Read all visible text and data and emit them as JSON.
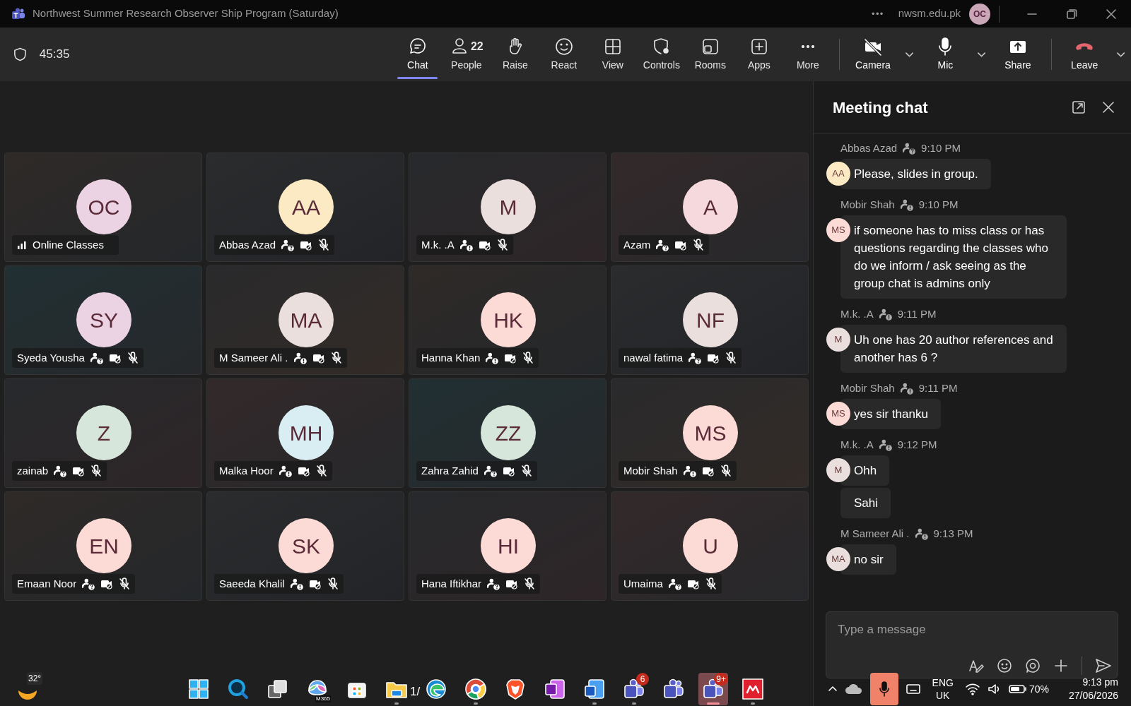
{
  "window": {
    "title": "Northwest Summer Research Observer Ship Program (Saturday)",
    "more": "•••",
    "org": "nwsm.edu.pk",
    "account_initials": "OC"
  },
  "toolbar": {
    "timer": "45:35",
    "buttons": [
      {
        "kind": "chat",
        "label": "Chat",
        "selected": true
      },
      {
        "kind": "people",
        "label": "People",
        "count": "22",
        "selected": false
      },
      {
        "kind": "raise",
        "label": "Raise",
        "selected": false
      },
      {
        "kind": "react",
        "label": "React",
        "selected": false
      },
      {
        "kind": "view",
        "label": "View",
        "selected": false
      },
      {
        "kind": "controls",
        "label": "Controls",
        "selected": false
      },
      {
        "kind": "rooms",
        "label": "Rooms",
        "selected": false
      },
      {
        "kind": "apps",
        "label": "Apps",
        "selected": false
      },
      {
        "kind": "more",
        "label": "More",
        "selected": false
      }
    ],
    "media": [
      {
        "kind": "camera",
        "label": "Camera",
        "dropdown": true
      },
      {
        "kind": "mic",
        "label": "Mic",
        "dropdown": true
      },
      {
        "kind": "share",
        "label": "Share",
        "dropdown": false
      },
      {
        "kind": "leave",
        "label": "Leave",
        "dropdown": true
      }
    ]
  },
  "participants": [
    {
      "kind": "self",
      "initials": "OC",
      "name": "Online Classes",
      "color": "#ecd3e3"
    },
    {
      "kind": "guest",
      "initials": "AA",
      "name": "Abbas Azad",
      "verified": false,
      "color": "#fbeac3"
    },
    {
      "kind": "guest",
      "initials": "M",
      "name": "M.k. .A",
      "verified": true,
      "color": "#eadfdc"
    },
    {
      "kind": "guest",
      "initials": "A",
      "name": "Azam",
      "verified": false,
      "color": "#f6d9dc"
    },
    {
      "kind": "guest",
      "initials": "SY",
      "name": "Syeda Yousha",
      "verified": false,
      "color": "#ecd3e3"
    },
    {
      "kind": "guest",
      "initials": "MA",
      "name": "M Sameer Ali .",
      "verified": true,
      "color": "#eadfdc"
    },
    {
      "kind": "guest",
      "initials": "HK",
      "name": "Hanna Khan",
      "verified": true,
      "color": "#fcdad5"
    },
    {
      "kind": "guest",
      "initials": "NF",
      "name": "nawal fatima",
      "verified": false,
      "color": "#eadfdc"
    },
    {
      "kind": "guest",
      "initials": "Z",
      "name": "zainab",
      "verified": false,
      "color": "#d6e6da"
    },
    {
      "kind": "guest",
      "initials": "MH",
      "name": "Malka Hoor",
      "verified": true,
      "color": "#d9eef2"
    },
    {
      "kind": "guest",
      "initials": "ZZ",
      "name": "Zahra Zahid",
      "verified": false,
      "color": "#d6e6da"
    },
    {
      "kind": "guest",
      "initials": "MS",
      "name": "Mobir Shah",
      "verified": true,
      "color": "#fcdad5"
    },
    {
      "kind": "guest",
      "initials": "EN",
      "name": "Emaan Noor",
      "verified": false,
      "color": "#fcdad5"
    },
    {
      "kind": "guest",
      "initials": "SK",
      "name": "Saeeda Khalil",
      "verified": true,
      "color": "#fcdad5"
    },
    {
      "kind": "guest",
      "initials": "HI",
      "name": "Hana Iftikhar",
      "verified": false,
      "color": "#fcdad5"
    },
    {
      "kind": "guest",
      "initials": "U",
      "name": "Umaima",
      "verified": false,
      "color": "#fcdad5"
    }
  ],
  "chat": {
    "title": "Meeting chat",
    "groups": [
      {
        "sender": "Abbas Azad",
        "verified": false,
        "time": "9:10 PM",
        "initials": "AA",
        "color": "#fbeac3",
        "messages": [
          "Please, slides in group."
        ]
      },
      {
        "sender": "Mobir Shah",
        "verified": true,
        "time": "9:10 PM",
        "initials": "MS",
        "color": "#fcdad5",
        "messages": [
          "if someone has to miss class or has questions  regarding the classes who do we inform / ask seeing as the group chat is admins only"
        ]
      },
      {
        "sender": "M.k. .A",
        "verified": true,
        "time": "9:11 PM",
        "initials": "M",
        "color": "#eadfdc",
        "messages": [
          "Uh one has 20 author references and another has 6 ?"
        ]
      },
      {
        "sender": "Mobir Shah",
        "verified": true,
        "time": "9:11 PM",
        "initials": "MS",
        "color": "#fcdad5",
        "messages": [
          "yes sir thanku"
        ]
      },
      {
        "sender": "M.k. .A",
        "verified": true,
        "time": "9:12 PM",
        "initials": "M",
        "color": "#eadfdc",
        "messages": [
          "Ohh",
          "Sahi"
        ]
      },
      {
        "sender": "M Sameer Ali .",
        "verified": true,
        "time": "9:13 PM",
        "initials": "MA",
        "color": "#eadfdc",
        "messages": [
          "no sir"
        ]
      }
    ],
    "composer": {
      "placeholder": "Type a message"
    }
  },
  "taskbar": {
    "weather": "32°",
    "apps": [
      {
        "kind": "start",
        "running": false,
        "selected": false
      },
      {
        "kind": "search",
        "running": false,
        "selected": false
      },
      {
        "kind": "taskview",
        "running": false,
        "selected": false
      },
      {
        "kind": "m365",
        "label": "M365",
        "running": false,
        "selected": false
      },
      {
        "kind": "store",
        "running": false,
        "selected": false
      },
      {
        "kind": "explorer",
        "running": true,
        "selected": false
      },
      {
        "kind": "edge",
        "label": "1/",
        "running": false,
        "selected": false
      },
      {
        "kind": "chrome",
        "running": true,
        "selected": false
      },
      {
        "kind": "brave",
        "running": false,
        "selected": false
      },
      {
        "kind": "onenote",
        "running": false,
        "selected": false
      },
      {
        "kind": "word",
        "running": true,
        "selected": false
      },
      {
        "kind": "teams",
        "badge": "6",
        "running": true,
        "selected": false
      },
      {
        "kind": "teams",
        "running": false,
        "selected": false
      },
      {
        "kind": "teams",
        "badge": "9+",
        "running": true,
        "selected": true
      },
      {
        "kind": "red",
        "running": true,
        "selected": false
      }
    ],
    "language": "ENG",
    "region": "UK",
    "battery": "70%",
    "time": "9:13 pm",
    "date": "27/06/2026"
  }
}
